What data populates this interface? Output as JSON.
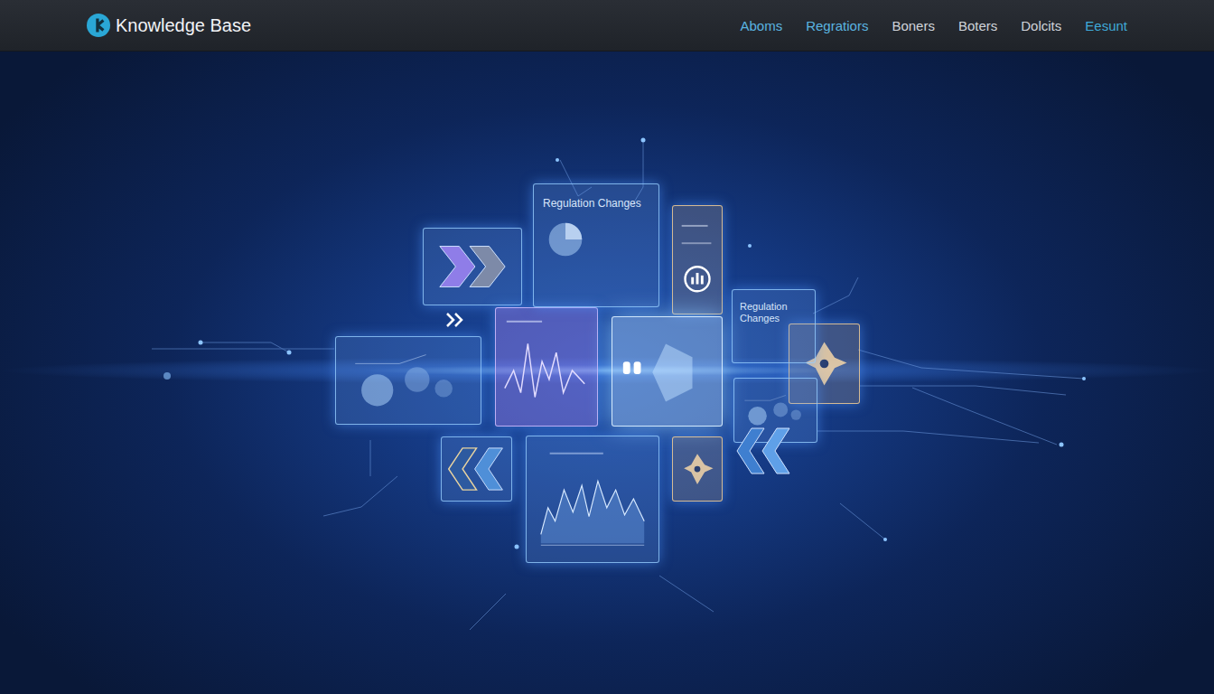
{
  "header": {
    "logo": {
      "title": "Knowledge Base"
    },
    "nav": [
      {
        "label": "Aboms",
        "color": "#5ab4e0"
      },
      {
        "label": "Regratiors",
        "color": "#5ab4e0"
      },
      {
        "label": "Boners",
        "color": "#d0d4da"
      },
      {
        "label": "Boters",
        "color": "#d0d4da"
      },
      {
        "label": "Dolcits",
        "color": "#d0d4da"
      },
      {
        "label": "Eesunt",
        "color": "#3fa9d8"
      }
    ]
  },
  "illustration": {
    "panels": [
      {
        "title": "Regulation Changes"
      },
      {
        "title": "Regulation Changes"
      }
    ]
  }
}
